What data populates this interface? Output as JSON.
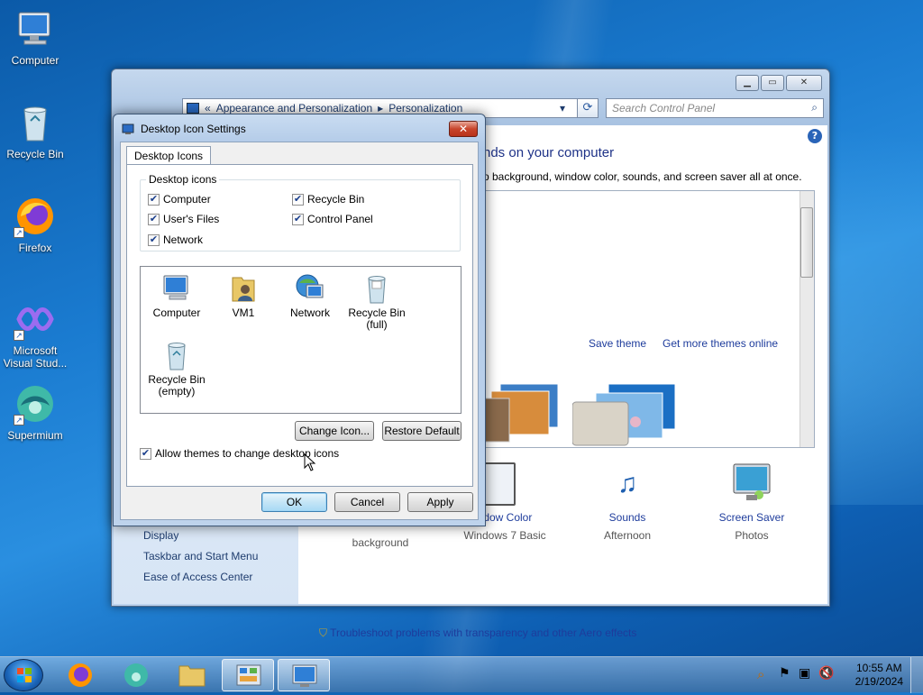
{
  "desktop": {
    "icons": [
      {
        "label": "Computer"
      },
      {
        "label": "Recycle Bin"
      },
      {
        "label": "Firefox"
      },
      {
        "label": "Microsoft Visual Stud..."
      },
      {
        "label": "Supermium"
      }
    ]
  },
  "control_panel": {
    "breadcrumb_prefix": "«",
    "breadcrumb": [
      "Appearance and Personalization",
      "Personalization"
    ],
    "search_placeholder": "Search Control Panel",
    "heading": "nds on your computer",
    "subheading": "p background, window color, sounds, and screen saver all at once.",
    "save_theme": "Save theme",
    "get_more_themes": "Get more themes online",
    "left_links": [
      "Display",
      "Taskbar and Start Menu",
      "Ease of Access Center"
    ],
    "bottom_items": [
      {
        "title": "",
        "sub": "background"
      },
      {
        "title": "ndow Color",
        "sub": "Windows 7 Basic"
      },
      {
        "title": "Sounds",
        "sub": "Afternoon"
      },
      {
        "title": "Screen Saver",
        "sub": "Photos"
      }
    ],
    "troubleshoot": "Troubleshoot problems with transparency and other Aero effects"
  },
  "dialog": {
    "title": "Desktop Icon Settings",
    "close": "✕",
    "tab": "Desktop Icons",
    "group_label": "Desktop icons",
    "checkboxes": [
      {
        "label": "Computer",
        "checked": true
      },
      {
        "label": "Recycle Bin",
        "checked": true
      },
      {
        "label": "User's Files",
        "checked": true
      },
      {
        "label": "Control Panel",
        "checked": true
      },
      {
        "label": "Network",
        "checked": true
      }
    ],
    "icons": [
      {
        "label": "Computer"
      },
      {
        "label": "VM1"
      },
      {
        "label": "Network"
      },
      {
        "label": "Recycle Bin (full)"
      },
      {
        "label": "Recycle Bin (empty)"
      }
    ],
    "change_icon": "Change Icon...",
    "restore_default": "Restore Default",
    "allow_themes": "Allow themes to change desktop icons",
    "allow_themes_checked": true,
    "ok": "OK",
    "cancel": "Cancel",
    "apply": "Apply"
  },
  "taskbar": {
    "time": "10:55 AM",
    "date": "2/19/2024"
  }
}
